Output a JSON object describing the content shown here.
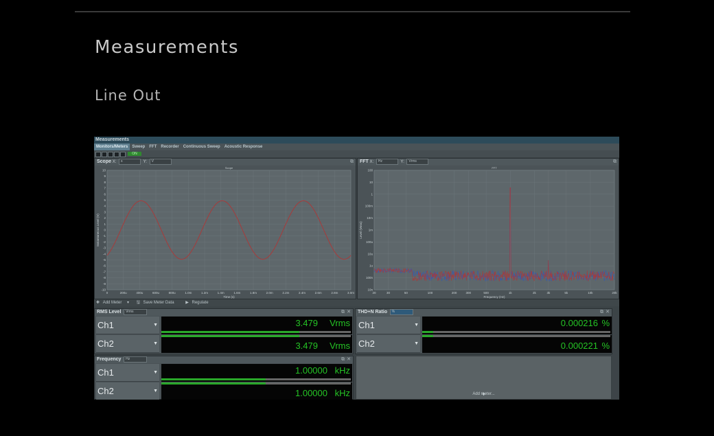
{
  "page": {
    "heading": "Measurements",
    "subheading": "Line Out"
  },
  "app": {
    "window_title": "Measurements",
    "tabs": [
      "Monitors/Meters",
      "Sweep",
      "FFT",
      "Recorder",
      "Continuous Sweep",
      "Acoustic Response"
    ],
    "active_tab": 0,
    "toolbar_on_label": "ON",
    "scope": {
      "title": "Scope",
      "x_label_prefix": "X:",
      "x_unit": "s",
      "y_label_prefix": "Y:",
      "y_unit": "V",
      "plot_title": "Scope",
      "ylabel": "Instantaneous Level (V)",
      "xlabel": "Time (s)",
      "y_ticks": [
        "10",
        "9",
        "8",
        "7",
        "6",
        "5",
        "4",
        "3",
        "2",
        "1",
        "0",
        "-1",
        "-2",
        "-3",
        "-4",
        "-5",
        "-6",
        "-7",
        "-8",
        "-9",
        "-10"
      ],
      "x_ticks": [
        "0",
        "200u",
        "400u",
        "600u",
        "800u",
        "1.0m",
        "1.2m",
        "1.4m",
        "1.6m",
        "1.8m",
        "2.0m",
        "2.2m",
        "2.4m",
        "2.6m",
        "2.8m",
        "3.0m"
      ]
    },
    "fft": {
      "title": "FFT",
      "x_label_prefix": "X:",
      "x_unit": "Hz",
      "y_label_prefix": "Y:",
      "y_unit": "Vrms",
      "plot_title": "FFT",
      "ylabel": "Level (Vrms)",
      "xlabel": "Frequency (Hz)",
      "y_ticks": [
        "100",
        "10",
        "1",
        "100m",
        "10m",
        "1m",
        "100u",
        "10u",
        "1u",
        "100n",
        "10n"
      ],
      "x_ticks": [
        "20",
        "30",
        "50",
        "100",
        "200",
        "300",
        "500",
        "1k",
        "2k",
        "3k",
        "5k",
        "10k",
        "20k"
      ]
    },
    "midbar": {
      "add_meter": "Add Meter",
      "save_meter_data": "Save Meter Data",
      "regulate": "Regulate"
    },
    "rms": {
      "title": "RMS Level",
      "unit_select": "Vrms",
      "rows": [
        {
          "label": "Ch1",
          "value": "3.479",
          "unit": "Vrms",
          "bar_fraction": 0.73
        },
        {
          "label": "Ch2",
          "value": "3.479",
          "unit": "Vrms",
          "bar_fraction": 0.73
        }
      ]
    },
    "thdn": {
      "title": "THD+N Ratio",
      "unit_select": "%",
      "rows": [
        {
          "label": "Ch1",
          "value": "0.000216",
          "unit": "%",
          "bar_fraction": 0.06
        },
        {
          "label": "Ch2",
          "value": "0.000221",
          "unit": "%",
          "bar_fraction": 0.06
        }
      ]
    },
    "frequency": {
      "title": "Frequency",
      "unit_select": "Hz",
      "rows": [
        {
          "label": "Ch1",
          "value": "1.00000",
          "unit": "kHz",
          "bar_fraction": 0.55
        },
        {
          "label": "Ch2",
          "value": "1.00000",
          "unit": "kHz",
          "bar_fraction": 0.55
        }
      ]
    },
    "add_meter_placeholder": "Add meter...",
    "colors": {
      "trace_ch1": "#a83a3a",
      "trace_ch2": "#3a5aa8",
      "meter_green": "#25c425"
    }
  }
}
